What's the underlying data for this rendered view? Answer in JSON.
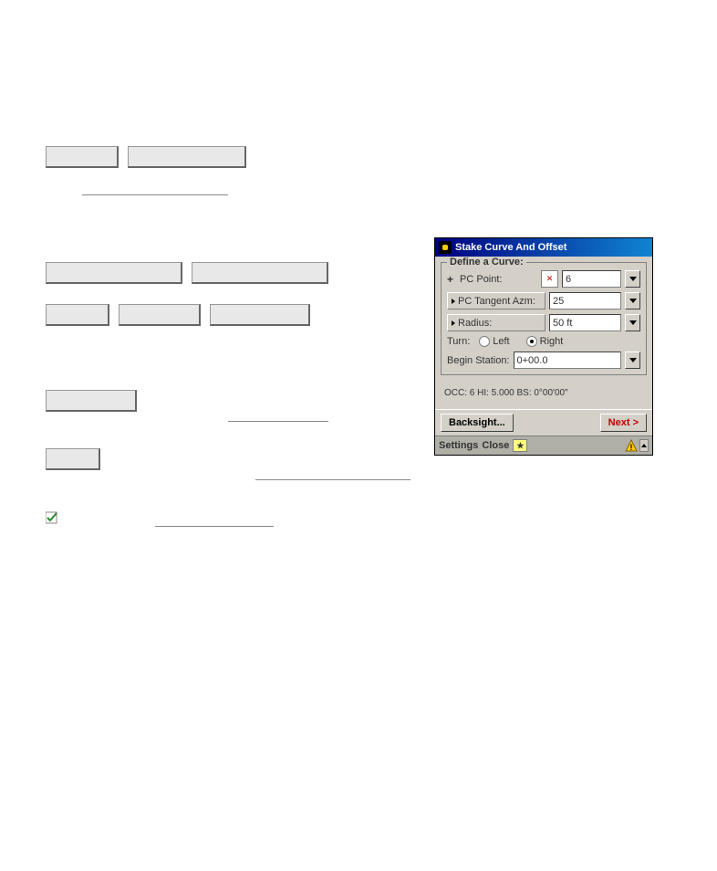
{
  "dialog": {
    "title": "Stake Curve And Offset",
    "legend": "Define a Curve:",
    "fields": {
      "pc_point_label": "PC Point:",
      "pc_point_value": "6",
      "pc_tangent_label": "PC Tangent Azm:",
      "pc_tangent_value": "25",
      "radius_label": "Radius:",
      "radius_value": "50 ft",
      "turn_label": "Turn:",
      "turn_left": "Left",
      "turn_right": "Right",
      "begin_station_label": "Begin Station:",
      "begin_station_value": "0+00.0"
    },
    "status": "OCC: 6  HI: 5.000  BS: 0°00'00\"",
    "buttons": {
      "backsight": "Backsight...",
      "next": "Next  >"
    },
    "bottom": {
      "settings": "Settings",
      "close": "Close"
    }
  }
}
